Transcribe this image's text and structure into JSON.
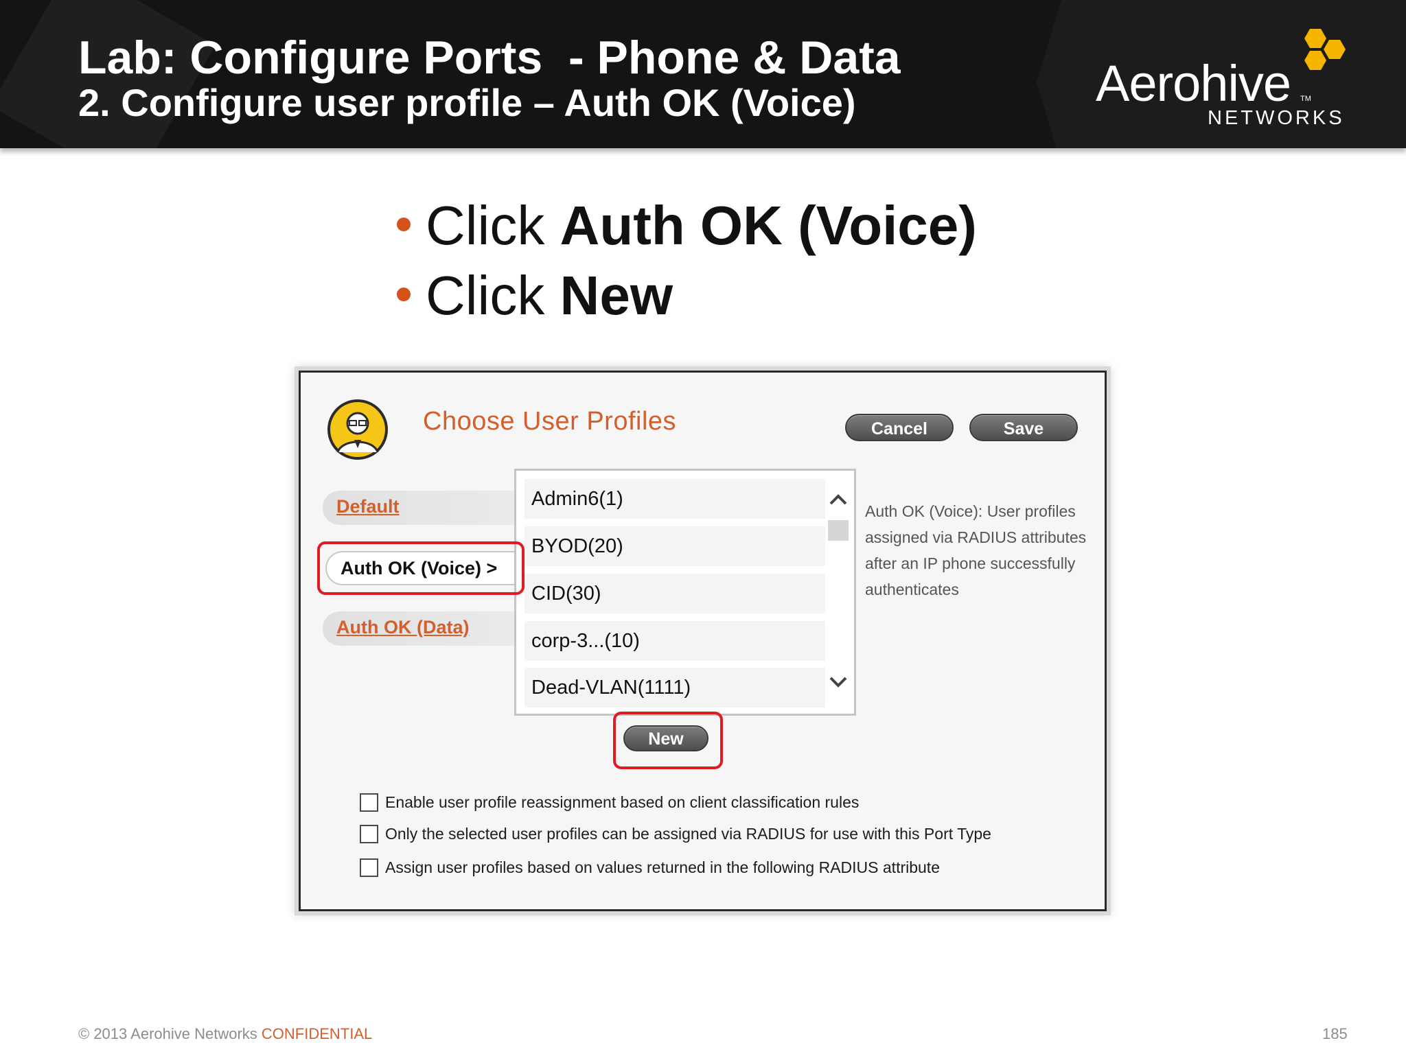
{
  "header": {
    "title": "Lab: Configure Ports  - Phone & Data",
    "subtitle": "2. Configure user profile – Auth OK (Voice)"
  },
  "logo": {
    "wordmark": "Aerohive",
    "tm": "TM",
    "tagline": "NETWORKS",
    "hex_color": "#f5b400"
  },
  "bullets": [
    {
      "prefix": "Click ",
      "bold": "Auth OK (Voice)"
    },
    {
      "prefix": "Click ",
      "bold": "New"
    }
  ],
  "dialog": {
    "title": "Choose User Profiles",
    "cancel_label": "Cancel",
    "save_label": "Save",
    "tabs": {
      "default": "Default",
      "auth_ok_voice": "Auth OK (Voice) >",
      "auth_ok_data": "Auth OK (Data)"
    },
    "profiles": [
      "Admin6(1)",
      "BYOD(20)",
      "CID(30)",
      "corp-3...(10)",
      "Dead-VLAN(1111)"
    ],
    "description": "Auth OK (Voice): User profiles assigned via RADIUS attributes after an IP phone successfully authenticates",
    "new_label": "New",
    "options": [
      "Enable user profile reassignment based on client classification rules",
      "Only the selected user profiles can be assigned via RADIUS for use with this Port Type",
      "Assign user profiles based on values returned in the following RADIUS attribute"
    ]
  },
  "footer": {
    "copyright": "© 2013 Aerohive Networks ",
    "confidential": "CONFIDENTIAL",
    "page_number": "185"
  },
  "colors": {
    "accent_orange": "#d35f2c",
    "highlight_red": "#e11b22",
    "header_bg": "#141414"
  }
}
